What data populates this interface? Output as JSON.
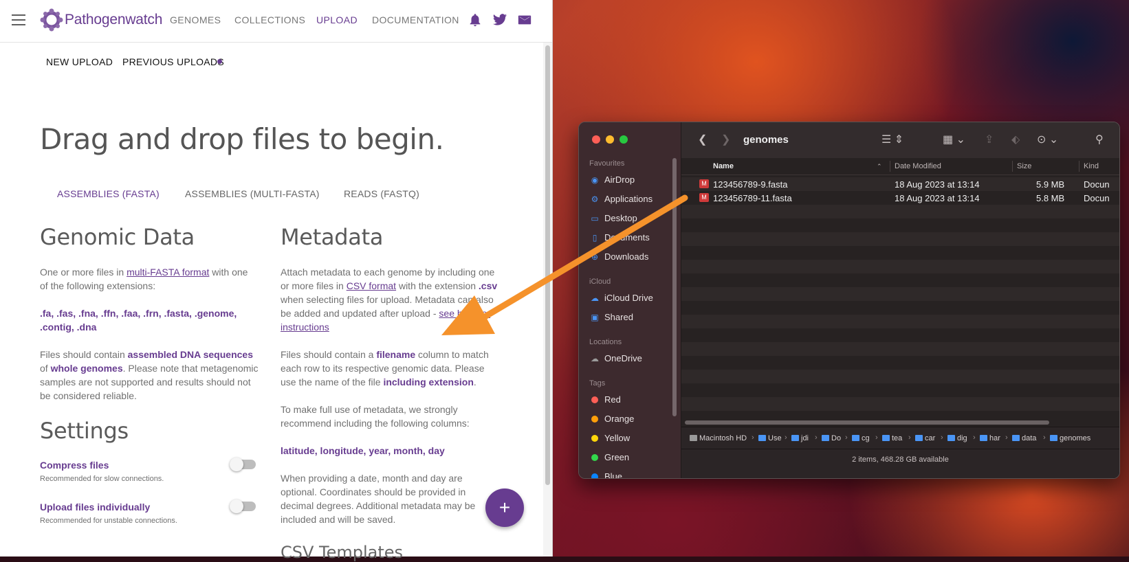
{
  "browser": {
    "brand": "Pathogenwatch",
    "nav": [
      "GENOMES",
      "COLLECTIONS",
      "UPLOAD",
      "DOCUMENTATION"
    ],
    "active_nav": "UPLOAD",
    "icons": [
      "menu-icon",
      "bell-icon",
      "twitter-icon",
      "mail-icon"
    ],
    "subtabs": {
      "new_upload": "NEW UPLOAD",
      "previous_uploads": "PREVIOUS UPLOADS"
    },
    "headline": "Drag and drop files to begin.",
    "format_tabs": [
      "ASSEMBLIES (FASTA)",
      "ASSEMBLIES (MULTI-FASTA)",
      "READS (FASTQ)"
    ],
    "genomic": {
      "heading": "Genomic Data",
      "p1_a": "One or more files in ",
      "p1_link": "multi-FASTA format",
      "p1_b": " with one of the following extensions:",
      "extensions_line1": ".fa, .fas, .fna, .ffn, .faa, .frn, .fasta, .genome,",
      "extensions_line2": ".contig, .dna",
      "p2_a": "Files should contain ",
      "p2_em1": "assembled DNA sequences",
      "p2_b": " of ",
      "p2_em2": "whole genomes",
      "p2_c": ". Please note that metagenomic samples are not supported and results should not be considered reliable."
    },
    "settings": {
      "heading": "Settings",
      "compress_title": "Compress files",
      "compress_sub": "Recommended for slow connections.",
      "individual_title": "Upload files individually",
      "individual_sub": "Recommended for unstable connections."
    },
    "metadata": {
      "heading": "Metadata",
      "p1_a": "Attach metadata to each genome by including one or more files in ",
      "p1_link": "CSV format",
      "p1_b": " with the extension ",
      "p1_ext": ".csv",
      "p1_c": " when selecting files for upload. Metadata can also be added and updated after upload - ",
      "p1_link2": "see here for instructions",
      "p2_a": "Files should contain a ",
      "p2_em1": "filename",
      "p2_b": " column to match each row to its respective genomic data. Please use the name of the file ",
      "p2_em2": "including extension",
      "p2_c": ".",
      "p3": "To make full use of metadata, we strongly recommend including the following columns:",
      "columns": "latitude, longitude, year, month, day",
      "p4": "When providing a date, month and day are optional. Coordinates should be provided in decimal degrees. Additional metadata may be included and will be saved.",
      "csv_heading": "CSV Templates"
    },
    "fab_label": "+"
  },
  "finder": {
    "title": "genomes",
    "sidebar": {
      "favourites_label": "Favourites",
      "favourites": [
        "AirDrop",
        "Applications",
        "Desktop",
        "Documents",
        "Downloads"
      ],
      "icloud_label": "iCloud",
      "icloud": [
        "iCloud Drive",
        "Shared"
      ],
      "locations_label": "Locations",
      "locations": [
        "OneDrive"
      ],
      "tags_label": "Tags",
      "tags": [
        {
          "name": "Red",
          "color": "#ff5f57"
        },
        {
          "name": "Orange",
          "color": "#ff9f0a"
        },
        {
          "name": "Yellow",
          "color": "#ffd60a"
        },
        {
          "name": "Green",
          "color": "#32d74b"
        },
        {
          "name": "Blue",
          "color": "#0a84ff"
        }
      ]
    },
    "columns": [
      "Name",
      "Date Modified",
      "Size",
      "Kind"
    ],
    "files": [
      {
        "name": "123456789-9.fasta",
        "date": "18 Aug 2023 at 13:14",
        "size": "5.9 MB",
        "kind": "Docun"
      },
      {
        "name": "123456789-11.fasta",
        "date": "18 Aug 2023 at 13:14",
        "size": "5.8 MB",
        "kind": "Docun"
      }
    ],
    "path": [
      "Macintosh HD",
      "Use",
      "jdi",
      "Do",
      "cg",
      "tea",
      "car",
      "dig",
      "har",
      "data",
      "genomes"
    ],
    "status": "2 items, 468.28 GB available"
  },
  "colors": {
    "brand": "#673c90",
    "arrow": "#f5922b"
  }
}
